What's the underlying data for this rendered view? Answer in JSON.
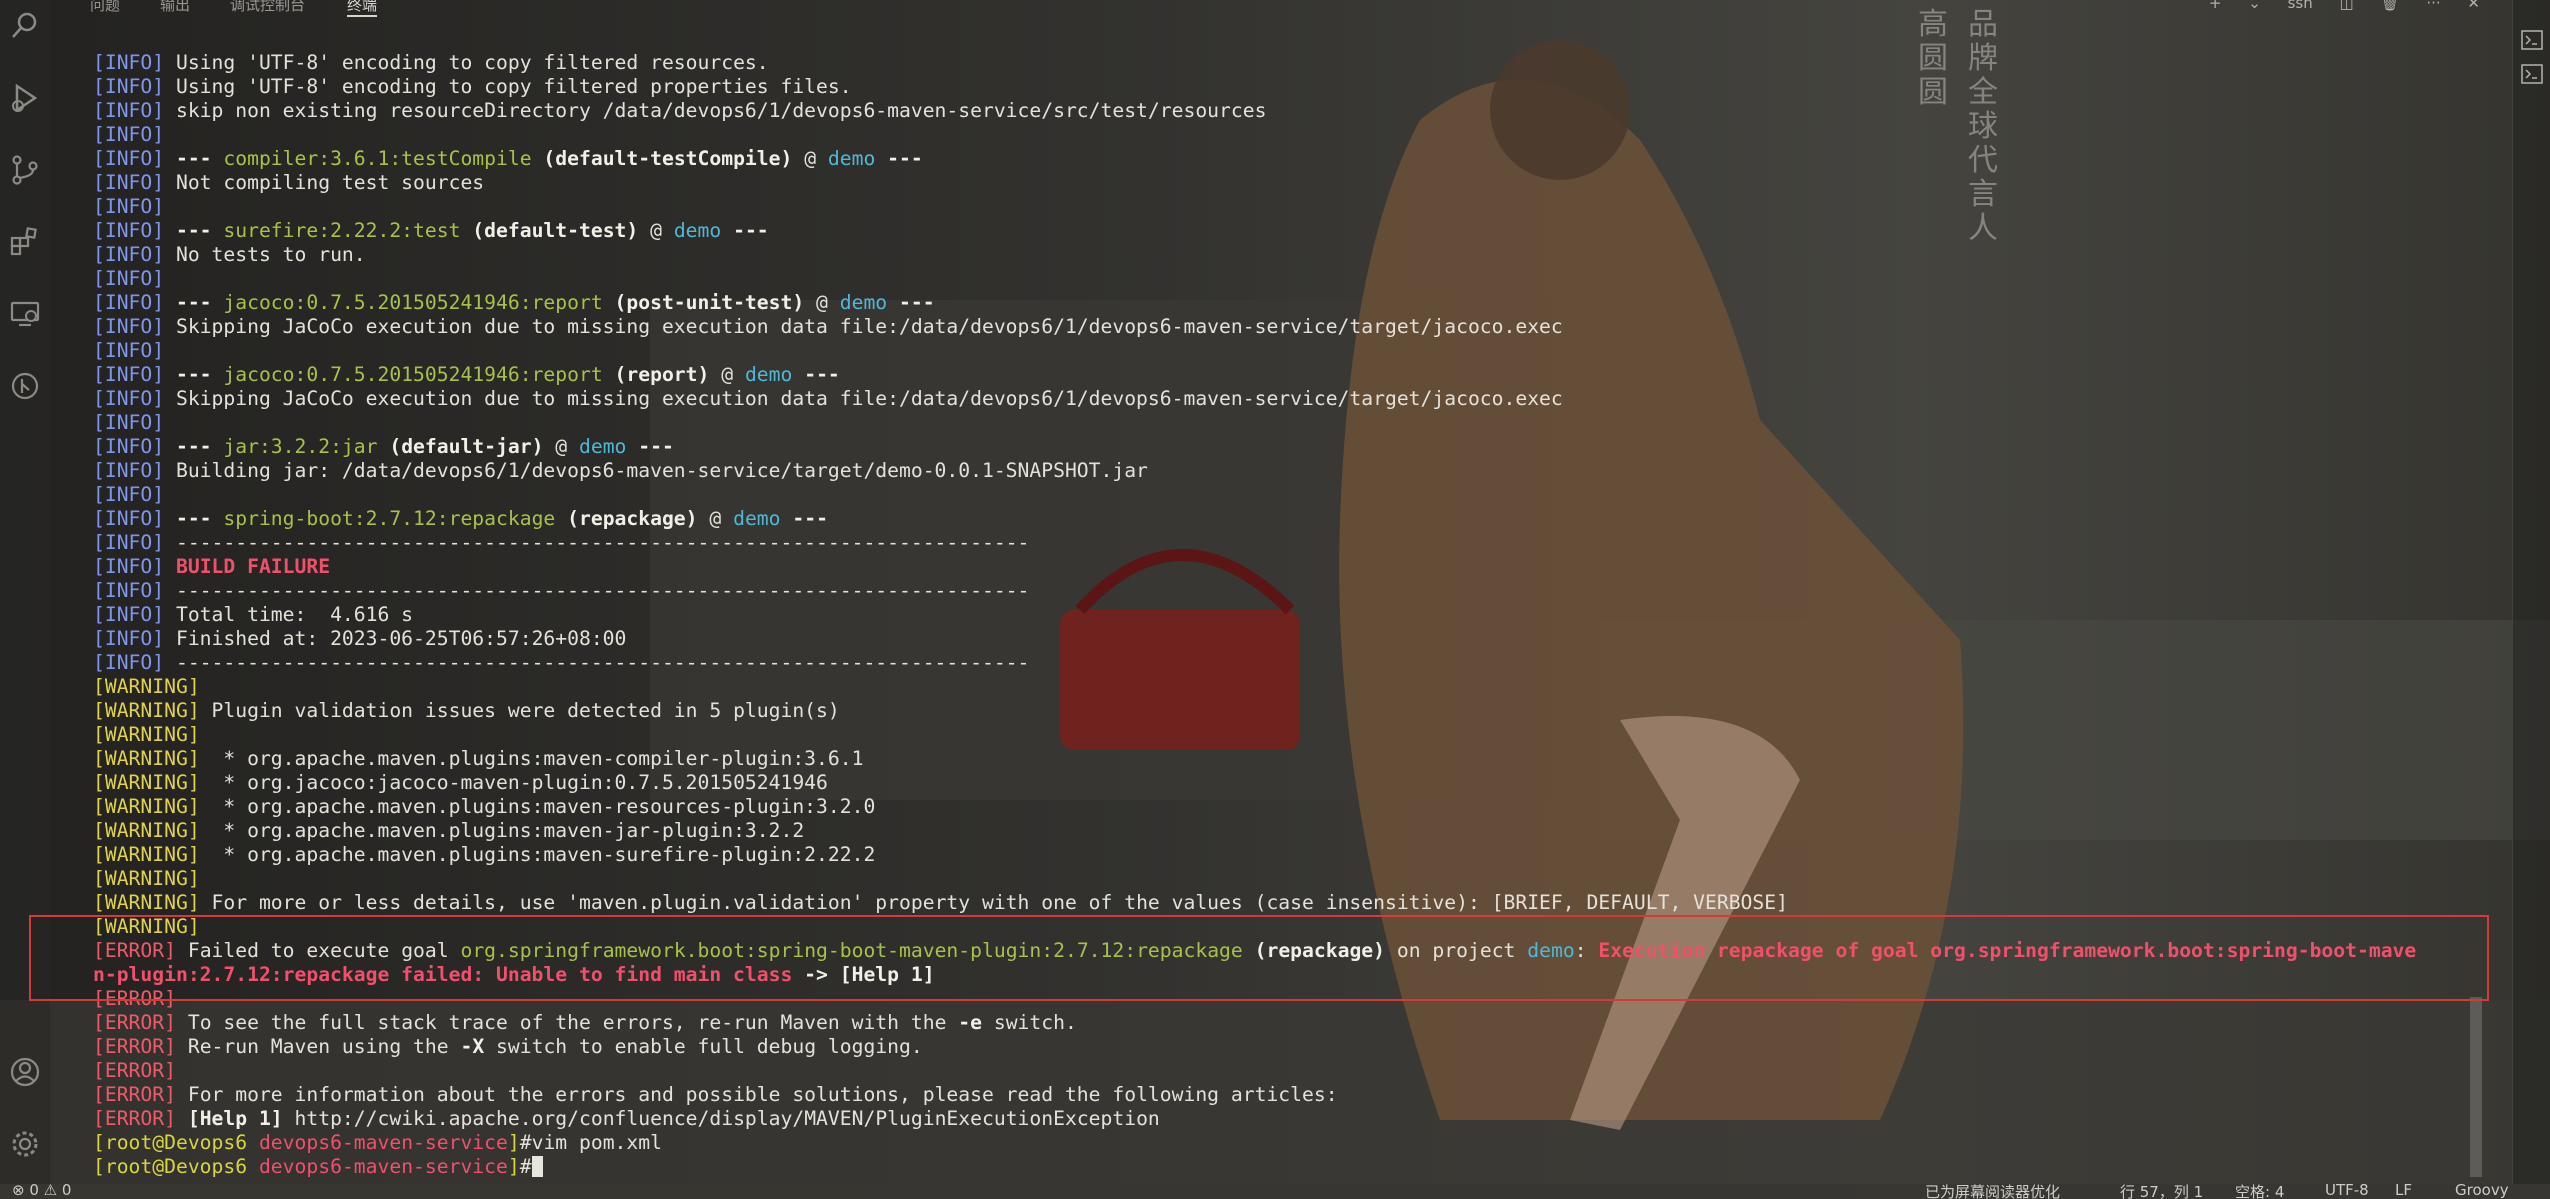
{
  "panel": {
    "tabs": [
      {
        "label": "问题"
      },
      {
        "label": "输出"
      },
      {
        "label": "调试控制台"
      },
      {
        "label": "终端"
      }
    ],
    "actions": {
      "add": "+",
      "dropdown": "⌄",
      "ssh": "ssh",
      "split": "◫",
      "trash": "🗑",
      "more": "···",
      "close": "✕"
    }
  },
  "poster": {
    "col1": "品牌全球代言人",
    "col2": "高圆圆"
  },
  "terminal": {
    "lines": [
      [
        {
          "c": "info",
          "t": "[INFO]"
        },
        {
          "c": "",
          "t": " Using 'UTF-8' encoding to copy filtered resources."
        }
      ],
      [
        {
          "c": "info",
          "t": "[INFO]"
        },
        {
          "c": "",
          "t": " Using 'UTF-8' encoding to copy filtered properties files."
        }
      ],
      [
        {
          "c": "info",
          "t": "[INFO]"
        },
        {
          "c": "",
          "t": " skip non existing resourceDirectory /data/devops6/1/devops6-maven-service/src/test/resources"
        }
      ],
      [
        {
          "c": "info",
          "t": "[INFO]"
        }
      ],
      [
        {
          "c": "info",
          "t": "[INFO]"
        },
        {
          "c": "bold",
          "t": " --- "
        },
        {
          "c": "plugin",
          "t": "compiler:3.6.1:testCompile"
        },
        {
          "c": "bold",
          "t": " (default-testCompile)"
        },
        {
          "c": "",
          "t": " @ "
        },
        {
          "c": "proj",
          "t": "demo"
        },
        {
          "c": "bold",
          "t": " ---"
        }
      ],
      [
        {
          "c": "info",
          "t": "[INFO]"
        },
        {
          "c": "",
          "t": " Not compiling test sources"
        }
      ],
      [
        {
          "c": "info",
          "t": "[INFO]"
        }
      ],
      [
        {
          "c": "info",
          "t": "[INFO]"
        },
        {
          "c": "bold",
          "t": " --- "
        },
        {
          "c": "plugin",
          "t": "surefire:2.22.2:test"
        },
        {
          "c": "bold",
          "t": " (default-test)"
        },
        {
          "c": "",
          "t": " @ "
        },
        {
          "c": "proj",
          "t": "demo"
        },
        {
          "c": "bold",
          "t": " ---"
        }
      ],
      [
        {
          "c": "info",
          "t": "[INFO]"
        },
        {
          "c": "",
          "t": " No tests to run."
        }
      ],
      [
        {
          "c": "info",
          "t": "[INFO]"
        }
      ],
      [
        {
          "c": "info",
          "t": "[INFO]"
        },
        {
          "c": "bold",
          "t": " --- "
        },
        {
          "c": "plugin",
          "t": "jacoco:0.7.5.201505241946:report"
        },
        {
          "c": "bold",
          "t": " (post-unit-test)"
        },
        {
          "c": "",
          "t": " @ "
        },
        {
          "c": "proj",
          "t": "demo"
        },
        {
          "c": "bold",
          "t": " ---"
        }
      ],
      [
        {
          "c": "info",
          "t": "[INFO]"
        },
        {
          "c": "",
          "t": " Skipping JaCoCo execution due to missing execution data file:/data/devops6/1/devops6-maven-service/target/jacoco.exec"
        }
      ],
      [
        {
          "c": "info",
          "t": "[INFO]"
        }
      ],
      [
        {
          "c": "info",
          "t": "[INFO]"
        },
        {
          "c": "bold",
          "t": " --- "
        },
        {
          "c": "plugin",
          "t": "jacoco:0.7.5.201505241946:report"
        },
        {
          "c": "bold",
          "t": " (report)"
        },
        {
          "c": "",
          "t": " @ "
        },
        {
          "c": "proj",
          "t": "demo"
        },
        {
          "c": "bold",
          "t": " ---"
        }
      ],
      [
        {
          "c": "info",
          "t": "[INFO]"
        },
        {
          "c": "",
          "t": " Skipping JaCoCo execution due to missing execution data file:/data/devops6/1/devops6-maven-service/target/jacoco.exec"
        }
      ],
      [
        {
          "c": "info",
          "t": "[INFO]"
        }
      ],
      [
        {
          "c": "info",
          "t": "[INFO]"
        },
        {
          "c": "bold",
          "t": " --- "
        },
        {
          "c": "plugin",
          "t": "jar:3.2.2:jar"
        },
        {
          "c": "bold",
          "t": " (default-jar)"
        },
        {
          "c": "",
          "t": " @ "
        },
        {
          "c": "proj",
          "t": "demo"
        },
        {
          "c": "bold",
          "t": " ---"
        }
      ],
      [
        {
          "c": "info",
          "t": "[INFO]"
        },
        {
          "c": "",
          "t": " Building jar: /data/devops6/1/devops6-maven-service/target/demo-0.0.1-SNAPSHOT.jar"
        }
      ],
      [
        {
          "c": "info",
          "t": "[INFO]"
        }
      ],
      [
        {
          "c": "info",
          "t": "[INFO]"
        },
        {
          "c": "bold",
          "t": " --- "
        },
        {
          "c": "plugin",
          "t": "spring-boot:2.7.12:repackage"
        },
        {
          "c": "bold",
          "t": " (repackage)"
        },
        {
          "c": "",
          "t": " @ "
        },
        {
          "c": "proj",
          "t": "demo"
        },
        {
          "c": "bold",
          "t": " ---"
        }
      ],
      [
        {
          "c": "info",
          "t": "[INFO]"
        },
        {
          "c": "",
          "t": " ------------------------------------------------------------------------"
        }
      ],
      [
        {
          "c": "info",
          "t": "[INFO]"
        },
        {
          "c": "",
          "t": " "
        },
        {
          "c": "failure",
          "t": "BUILD FAILURE"
        }
      ],
      [
        {
          "c": "info",
          "t": "[INFO]"
        },
        {
          "c": "",
          "t": " ------------------------------------------------------------------------"
        }
      ],
      [
        {
          "c": "info",
          "t": "[INFO]"
        },
        {
          "c": "",
          "t": " Total time:  4.616 s"
        }
      ],
      [
        {
          "c": "info",
          "t": "[INFO]"
        },
        {
          "c": "",
          "t": " Finished at: 2023-06-25T06:57:26+08:00"
        }
      ],
      [
        {
          "c": "info",
          "t": "[INFO]"
        },
        {
          "c": "",
          "t": " ------------------------------------------------------------------------"
        }
      ],
      [
        {
          "c": "warn",
          "t": "[WARNING]"
        }
      ],
      [
        {
          "c": "warn",
          "t": "[WARNING]"
        },
        {
          "c": "",
          "t": " Plugin validation issues were detected in 5 plugin(s)"
        }
      ],
      [
        {
          "c": "warn",
          "t": "[WARNING]"
        }
      ],
      [
        {
          "c": "warn",
          "t": "[WARNING]"
        },
        {
          "c": "",
          "t": "  * org.apache.maven.plugins:maven-compiler-plugin:3.6.1"
        }
      ],
      [
        {
          "c": "warn",
          "t": "[WARNING]"
        },
        {
          "c": "",
          "t": "  * org.jacoco:jacoco-maven-plugin:0.7.5.201505241946"
        }
      ],
      [
        {
          "c": "warn",
          "t": "[WARNING]"
        },
        {
          "c": "",
          "t": "  * org.apache.maven.plugins:maven-resources-plugin:3.2.0"
        }
      ],
      [
        {
          "c": "warn",
          "t": "[WARNING]"
        },
        {
          "c": "",
          "t": "  * org.apache.maven.plugins:maven-jar-plugin:3.2.2"
        }
      ],
      [
        {
          "c": "warn",
          "t": "[WARNING]"
        },
        {
          "c": "",
          "t": "  * org.apache.maven.plugins:maven-surefire-plugin:2.22.2"
        }
      ],
      [
        {
          "c": "warn",
          "t": "[WARNING]"
        }
      ],
      [
        {
          "c": "warn",
          "t": "[WARNING]"
        },
        {
          "c": "",
          "t": " For more or less details, use 'maven.plugin.validation' property with one of the values (case insensitive): [BRIEF, DEFAULT, VERBOSE]"
        }
      ],
      [
        {
          "c": "warn",
          "t": "[WARNING]"
        }
      ],
      [
        {
          "c": "err",
          "t": "[ERROR]"
        },
        {
          "c": "",
          "t": " Failed to execute goal "
        },
        {
          "c": "plugin",
          "t": "org.springframework.boot:spring-boot-maven-plugin:2.7.12:repackage"
        },
        {
          "c": "bold",
          "t": " (repackage)"
        },
        {
          "c": "",
          "t": " on project "
        },
        {
          "c": "proj",
          "t": "demo"
        },
        {
          "c": "",
          "t": ": "
        },
        {
          "c": "errmsg",
          "t": "Execution repackage of goal org.springframework.boot:spring-boot-mave"
        }
      ],
      [
        {
          "c": "errmsg",
          "t": "n-plugin:2.7.12:repackage failed: Unable to find main class"
        },
        {
          "c": "bold",
          "t": " -> [Help 1]"
        }
      ],
      [
        {
          "c": "err",
          "t": "[ERROR]"
        }
      ],
      [
        {
          "c": "err",
          "t": "[ERROR]"
        },
        {
          "c": "",
          "t": " To see the full stack trace of the errors, re-run Maven with the "
        },
        {
          "c": "bold",
          "t": "-e"
        },
        {
          "c": "",
          "t": " switch."
        }
      ],
      [
        {
          "c": "err",
          "t": "[ERROR]"
        },
        {
          "c": "",
          "t": " Re-run Maven using the "
        },
        {
          "c": "bold",
          "t": "-X"
        },
        {
          "c": "",
          "t": " switch to enable full debug logging."
        }
      ],
      [
        {
          "c": "err",
          "t": "[ERROR]"
        }
      ],
      [
        {
          "c": "err",
          "t": "[ERROR]"
        },
        {
          "c": "",
          "t": " For more information about the errors and possible solutions, please read the following articles:"
        }
      ],
      [
        {
          "c": "err",
          "t": "[ERROR]"
        },
        {
          "c": "bold",
          "t": " [Help 1]"
        },
        {
          "c": "",
          "t": " http://cwiki.apache.org/confluence/display/MAVEN/PluginExecutionException"
        }
      ],
      [
        {
          "c": "prompt-user",
          "t": "[root@Devops6 "
        },
        {
          "c": "prompt-dir",
          "t": "devops6-maven-service"
        },
        {
          "c": "prompt-user",
          "t": "]"
        },
        {
          "c": "",
          "t": "#vim pom.xml"
        }
      ],
      [
        {
          "c": "prompt-user",
          "t": "[root@Devops6 "
        },
        {
          "c": "prompt-dir",
          "t": "devops6-maven-service"
        },
        {
          "c": "prompt-user",
          "t": "]"
        },
        {
          "c": "",
          "t": "#"
        },
        {
          "c": "cursor",
          "t": ""
        }
      ]
    ]
  },
  "status_bar": {
    "problems": "⊗ 0  ⚠ 0",
    "screen_reader": "已为屏幕阅读器优化",
    "position": "行 57，列 1",
    "spaces": "空格: 4",
    "encoding": "UTF-8",
    "eol": "LF",
    "language": "Groovy"
  },
  "colors": {
    "info": "#7f95ee",
    "warning": "#e0d24a",
    "error": "#ee5a6b",
    "plugin": "#a6c24a",
    "project": "#4fb8d8",
    "highlight_box": "#d43a3a"
  }
}
